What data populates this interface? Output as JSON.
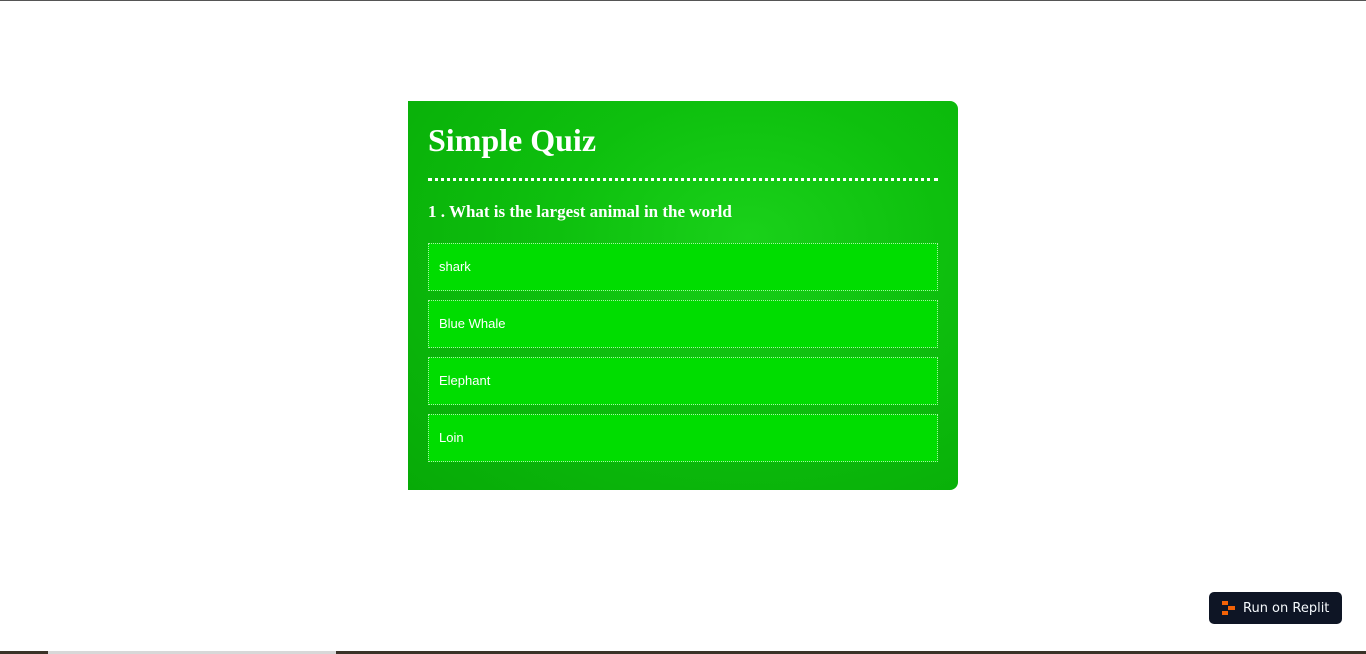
{
  "quiz": {
    "title": "Simple Quiz",
    "question": "1 . What is the largest animal in the world",
    "options": [
      {
        "label": "shark"
      },
      {
        "label": "Blue Whale"
      },
      {
        "label": "Elephant"
      },
      {
        "label": "Loin"
      }
    ]
  },
  "replit_button": {
    "label": "Run on Replit",
    "icon": "replit-icon",
    "accent": "#f26207"
  },
  "colors": {
    "card_green": "#0ec00e",
    "option_green": "#00dd00",
    "button_dark": "#0e1525"
  }
}
